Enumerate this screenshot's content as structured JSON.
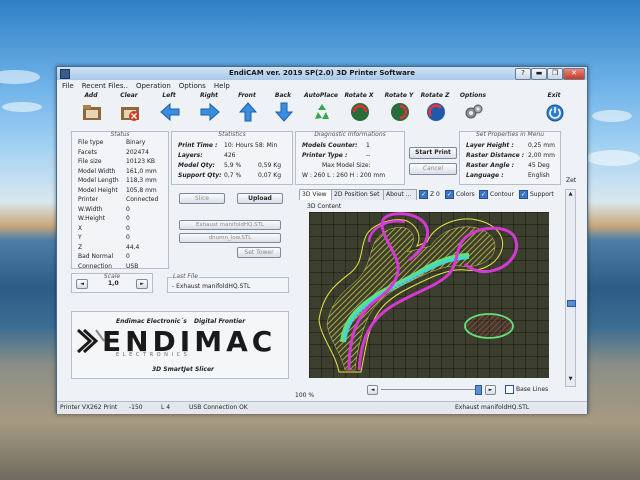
{
  "window": {
    "title": "EndiCAM ver. 2019  SP(2.0)        3D Printer Software",
    "controls": [
      "?",
      "▬",
      "❐",
      "✕"
    ]
  },
  "menu": [
    "File",
    "Recent Files..",
    "Operation",
    "Options",
    "Help"
  ],
  "toolbar": [
    {
      "label": "Add",
      "icon": "add-folder-icon"
    },
    {
      "label": "Clear",
      "icon": "clear-icon"
    },
    {
      "label": "Left",
      "icon": "arrow-left-icon"
    },
    {
      "label": "Right",
      "icon": "arrow-right-icon"
    },
    {
      "label": "Front",
      "icon": "arrow-up-icon"
    },
    {
      "label": "Back",
      "icon": "arrow-down-icon"
    },
    {
      "label": "AutoPlace",
      "icon": "recycle-icon"
    },
    {
      "label": "Rotate X",
      "icon": "rotate-x-icon"
    },
    {
      "label": "Rotate Y",
      "icon": "rotate-y-icon"
    },
    {
      "label": "Rotate Z",
      "icon": "rotate-z-icon"
    },
    {
      "label": "Options",
      "icon": "gears-icon"
    },
    {
      "label": "Exit",
      "icon": "power-icon"
    }
  ],
  "status": {
    "title": "Status",
    "rows": [
      {
        "k": "File type",
        "v": "Binary"
      },
      {
        "k": "Facets",
        "v": "202474"
      },
      {
        "k": "File size",
        "v": "10123 KB"
      },
      {
        "k": "Model Width",
        "v": "161,0 mm"
      },
      {
        "k": "Model Length",
        "v": "118,3 mm"
      },
      {
        "k": "Model Height",
        "v": "105,8 mm"
      },
      {
        "k": "Printer",
        "v": "Connected"
      },
      {
        "k": "W.Width",
        "v": "0"
      },
      {
        "k": "W.Height",
        "v": "0"
      },
      {
        "k": "X",
        "v": "0"
      },
      {
        "k": "Y",
        "v": "0"
      },
      {
        "k": "Z",
        "v": "44,4"
      },
      {
        "k": "Bad Normal",
        "v": "0"
      },
      {
        "k": "Connection",
        "v": "USB"
      }
    ]
  },
  "statistics": {
    "title": "Statistics",
    "print_time_label": "Print Time :",
    "print_time": "10: Hours 58: Min",
    "layers_label": "Layers:",
    "layers": "426",
    "model_qty_label": "Model Qty:",
    "model_qty_pct": "5,9  %",
    "model_qty_kg": "0,59  Kg",
    "support_qty_label": "Support Qty:",
    "support_qty_pct": "0,7  %",
    "support_qty_kg": "0,07  Kg"
  },
  "diagnostic": {
    "title": "Diagnostic Informations",
    "models_counter_label": "Models Counter:",
    "models_counter": "1",
    "printer_type_label": "Printer Type :",
    "printer_type": "--",
    "max_model_size_label": "Max Model Size:",
    "max_model_size": "W : 260 L : 260 H : 200  mm"
  },
  "start_print": "Start Print",
  "cancel": "Cancel",
  "properties": {
    "title": "Set Properties in Menu",
    "layer_height_label": "Layer Height :",
    "layer_height": "0,25 mm",
    "raster_distance_label": "Raster Distance :",
    "raster_distance": "2,00 mm",
    "raster_angle_label": "Raster Angle :",
    "raster_angle": "45 Deg",
    "language_label": "Language :",
    "language": "English"
  },
  "slice": "Slice",
  "upload": "Upload",
  "file_list": [
    "Exhaust manifoldHQ.STL",
    "dnumn_low.STL"
  ],
  "set_tower": "Set Tower",
  "scale": {
    "label": "Scale",
    "value": "1,0",
    "dec": "◄",
    "inc": "►"
  },
  "last_file": {
    "label": "Last File",
    "value": "- Exhaust manifoldHQ.STL"
  },
  "brand": {
    "left": "Endimac Electronic´s",
    "right": "Digital Frontier",
    "logo": "ENDIMAC",
    "logo_sub": "E L E C T R O N I C S",
    "tagline": "3D SmartJet Slicer"
  },
  "tabs": [
    "3D View",
    "2D Position Set",
    "About ..."
  ],
  "view_checks": [
    {
      "label": "Z 0",
      "checked": true
    },
    {
      "label": "Colors",
      "checked": true
    },
    {
      "label": "Contour",
      "checked": true
    },
    {
      "label": "Support",
      "checked": true
    }
  ],
  "content_label": "3D Content",
  "zet_label": "Zet",
  "zoom": "100 %",
  "base_lines": "Base Lines",
  "statusbar": {
    "printer": "Printer VX262 Print",
    "pos": "-150",
    "layer": "L 4",
    "usb": "USB Connection OK",
    "file": "Exhaust manifoldHQ.STL"
  },
  "colors": {
    "title_grad": "#a9c8ea",
    "view_bg": "#3d3f2e",
    "grid": "#0c0c0a",
    "magenta": "#d43ad1",
    "yellow": "#e9e443",
    "cyan": "#3fd6e1",
    "green": "#62e07a",
    "red": "#e0434a",
    "accent": "#3b76c9"
  }
}
